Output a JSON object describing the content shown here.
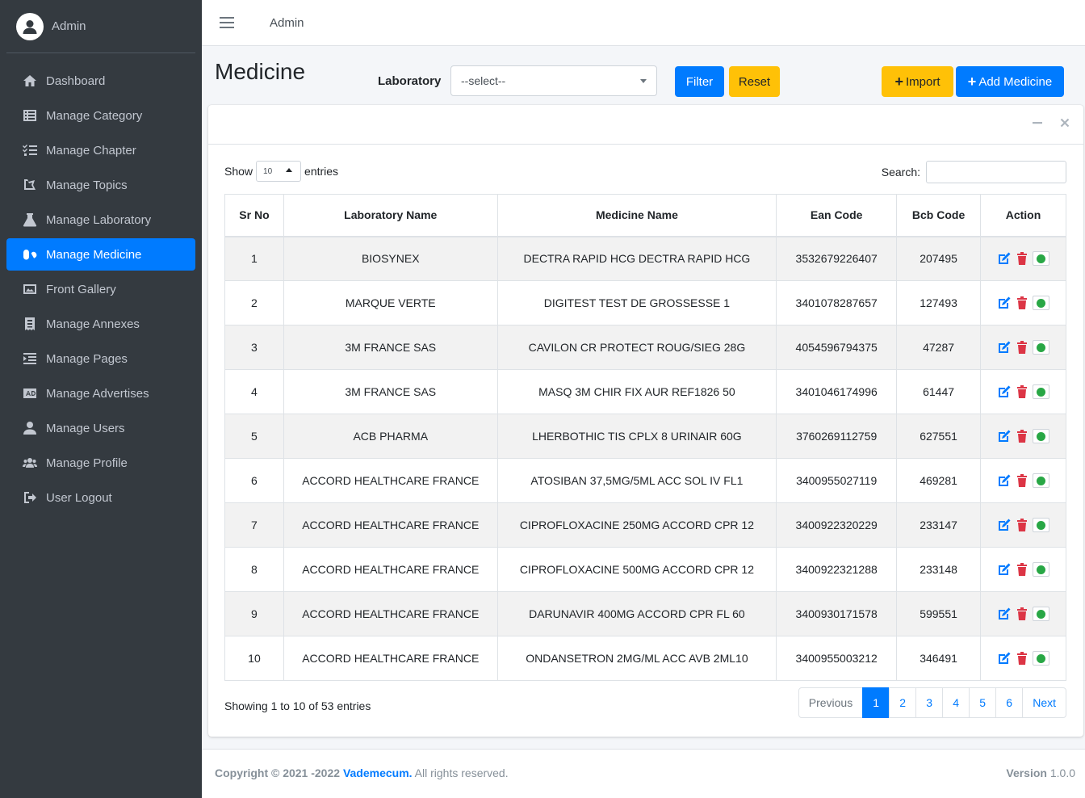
{
  "sidebar": {
    "user_name": "Admin",
    "items": [
      {
        "label": "Dashboard",
        "icon": "home-icon"
      },
      {
        "label": "Manage Category",
        "icon": "list-icon"
      },
      {
        "label": "Manage Chapter",
        "icon": "tasks-icon"
      },
      {
        "label": "Manage Topics",
        "icon": "book-open-icon"
      },
      {
        "label": "Manage Laboratory",
        "icon": "flask-icon"
      },
      {
        "label": "Manage Medicine",
        "icon": "capsules-icon"
      },
      {
        "label": "Front Gallery",
        "icon": "image-icon"
      },
      {
        "label": "Manage Annexes",
        "icon": "receipt-icon"
      },
      {
        "label": "Manage Pages",
        "icon": "indent-icon"
      },
      {
        "label": "Manage Advertises",
        "icon": "ad-icon"
      },
      {
        "label": "Manage Users",
        "icon": "user-icon"
      },
      {
        "label": "Manage Profile",
        "icon": "users-icon"
      },
      {
        "label": "User Logout",
        "icon": "sign-out-icon"
      }
    ]
  },
  "topbar": {
    "admin_label": "Admin"
  },
  "header": {
    "title": "Medicine",
    "lab_label": "Laboratory",
    "lab_select_value": "--select--",
    "filter_label": "Filter",
    "reset_label": "Reset",
    "import_label": "Import",
    "add_label": "Add Medicine"
  },
  "table_controls": {
    "show_label": "Show",
    "length_value": "10",
    "entries_label": "entries",
    "search_label": "Search:"
  },
  "table": {
    "headers": [
      "Sr No",
      "Laboratory Name",
      "Medicine Name",
      "Ean Code",
      "Bcb Code",
      "Action"
    ],
    "rows": [
      [
        "1",
        "BIOSYNEX",
        "DECTRA RAPID HCG DECTRA RAPID HCG",
        "3532679226407",
        "207495"
      ],
      [
        "2",
        "MARQUE VERTE",
        "DIGITEST TEST DE GROSSESSE 1",
        "3401078287657",
        "127493"
      ],
      [
        "3",
        "3M FRANCE SAS",
        "CAVILON CR PROTECT ROUG/SIEG 28G",
        "4054596794375",
        "47287"
      ],
      [
        "4",
        "3M FRANCE SAS",
        "MASQ 3M CHIR FIX AUR REF1826 50",
        "3401046174996",
        "61447"
      ],
      [
        "5",
        "ACB PHARMA",
        "LHERBOTHIC TIS CPLX 8 URINAIR 60G",
        "3760269112759",
        "627551"
      ],
      [
        "6",
        "ACCORD HEALTHCARE FRANCE",
        "ATOSIBAN 37,5MG/5ML ACC SOL IV FL1",
        "3400955027119",
        "469281"
      ],
      [
        "7",
        "ACCORD HEALTHCARE FRANCE",
        "CIPROFLOXACINE 250MG ACCORD CPR 12",
        "3400922320229",
        "233147"
      ],
      [
        "8",
        "ACCORD HEALTHCARE FRANCE",
        "CIPROFLOXACINE 500MG ACCORD CPR 12",
        "3400922321288",
        "233148"
      ],
      [
        "9",
        "ACCORD HEALTHCARE FRANCE",
        "DARUNAVIR 400MG ACCORD CPR FL 60",
        "3400930171578",
        "599551"
      ],
      [
        "10",
        "ACCORD HEALTHCARE FRANCE",
        "ONDANSETRON 2MG/ML ACC AVB 2ML10",
        "3400955003212",
        "346491"
      ]
    ]
  },
  "pagination": {
    "info": "Showing 1 to 10 of 53 entries",
    "previous": "Previous",
    "pages": [
      "1",
      "2",
      "3",
      "4",
      "5",
      "6"
    ],
    "current": "1",
    "next": "Next"
  },
  "footer": {
    "copyright_prefix": "Copyright © 2021 -2022",
    "brand": "Vademecum.",
    "rights": "All rights reserved.",
    "version_label": "Version",
    "version_value": "1.0.0"
  },
  "colors": {
    "sidebar_bg": "#343a40",
    "primary": "#007bff",
    "warning": "#ffc107",
    "danger": "#dc3545",
    "success": "#28a745"
  }
}
